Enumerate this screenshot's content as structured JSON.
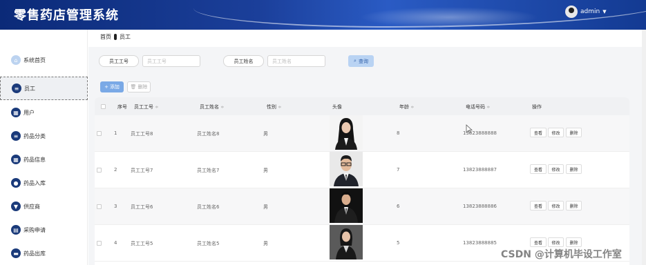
{
  "header": {
    "app_title": "零售药店管理系统",
    "username": "admin",
    "caret": "▼"
  },
  "breadcrumb": {
    "home": "首页",
    "current": "员工"
  },
  "sidebar": {
    "items": [
      {
        "label": "系统首页",
        "icon": "home-icon"
      },
      {
        "label": "员工",
        "icon": "list-icon",
        "active": true
      },
      {
        "label": "用户",
        "icon": "grid-icon"
      },
      {
        "label": "药品分类",
        "icon": "list-icon"
      },
      {
        "label": "药品信息",
        "icon": "grid-icon"
      },
      {
        "label": "药品入库",
        "icon": "person-icon"
      },
      {
        "label": "供应商",
        "icon": "shield-icon"
      },
      {
        "label": "采购申请",
        "icon": "document-icon"
      },
      {
        "label": "药品出库",
        "icon": "chat-icon"
      }
    ]
  },
  "search": {
    "emp_no_label": "员工工号",
    "emp_no_placeholder": "员工工号",
    "emp_name_label": "员工姓名",
    "emp_name_placeholder": "员工姓名",
    "query_label": "查询"
  },
  "toolbar": {
    "add_label": "添加",
    "delete_label": "删除"
  },
  "table": {
    "columns": {
      "index": "序号",
      "emp_no": "员工工号",
      "emp_name": "员工姓名",
      "gender": "性别",
      "avatar": "头像",
      "age": "年龄",
      "phone": "电话号码",
      "actions": "操作"
    },
    "sort_glyph": "≑",
    "rows": [
      {
        "index": "1",
        "emp_no": "员工工号8",
        "emp_name": "员工姓名8",
        "gender": "男",
        "age": "8",
        "phone": "13823888888"
      },
      {
        "index": "2",
        "emp_no": "员工工号7",
        "emp_name": "员工姓名7",
        "gender": "男",
        "age": "7",
        "phone": "13823888887"
      },
      {
        "index": "3",
        "emp_no": "员工工号6",
        "emp_name": "员工姓名6",
        "gender": "男",
        "age": "6",
        "phone": "13823888886"
      },
      {
        "index": "4",
        "emp_no": "员工工号5",
        "emp_name": "员工姓名5",
        "gender": "男",
        "age": "5",
        "phone": "13823888885"
      }
    ],
    "actions": {
      "view": "查看",
      "edit": "修改",
      "delete": "删除"
    }
  },
  "watermark": "CSDN @计算机毕设工作室"
}
